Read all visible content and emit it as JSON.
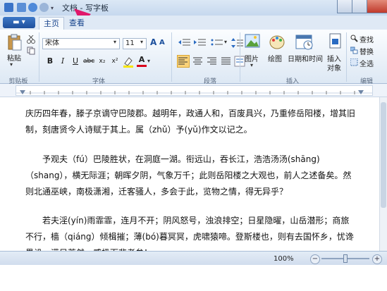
{
  "window": {
    "title": "文档 - 写字板"
  },
  "menu": {
    "tabs": [
      {
        "label": "主页",
        "active": true
      },
      {
        "label": "查看",
        "active": false
      }
    ]
  },
  "ribbon": {
    "clipboard": {
      "paste_label": "粘贴",
      "group_label": "剪贴板"
    },
    "font": {
      "family_value": "宋体",
      "size_value": "11",
      "bold_label": "B",
      "italic_label": "I",
      "underline_label": "U",
      "font_color_label": "A",
      "group_label": "字体"
    },
    "paragraph": {
      "group_label": "段落"
    },
    "insert": {
      "picture_label": "图片",
      "paint_label": "绘图",
      "datetime_label": "日期和时间",
      "object_label_1": "插入",
      "object_label_2": "对象",
      "group_label": "插入"
    },
    "edit": {
      "find_label": "查找",
      "replace_label": "替换",
      "select_all_label": "全选",
      "group_label": "编辑"
    }
  },
  "document": {
    "paragraphs": [
      [
        "庆历四年春，滕子京谪守巴陵郡。越明年，政通人和，百废具兴，乃重修岳阳楼，增其旧",
        "制，刻唐贤今人诗赋于其上。属（zhǔ）予(yǔ)作文以记之。"
      ],
      [
        "予观夫（fú）巴陵胜状，在洞庭一湖。衔远山，吞长江，浩浩汤汤(shāng)",
        "（shang），横无际涯；朝晖夕阴，气象万千；此则岳阳楼之大观也，前人之述备矣。然",
        "则北通巫峡，南极潇湘，迁客骚人，多会于此，览物之情，得无异乎？"
      ],
      [
        "若夫淫(yín)雨霏霏，连月不开；阴风怒号，浊浪排空；日星隐曜，山岳潜形；商旅",
        "不行，樯（qiáng）倾楫摧；薄(bó)暮冥冥，虎啸猿啼。登斯楼也，则有去国怀乡，忧谗",
        "畏讥，满目萧然，感极而悲者矣！"
      ]
    ]
  },
  "status": {
    "zoom": "100%"
  },
  "colors": {
    "accent": "#e0176b",
    "ribbon_blue": "#15428b"
  }
}
